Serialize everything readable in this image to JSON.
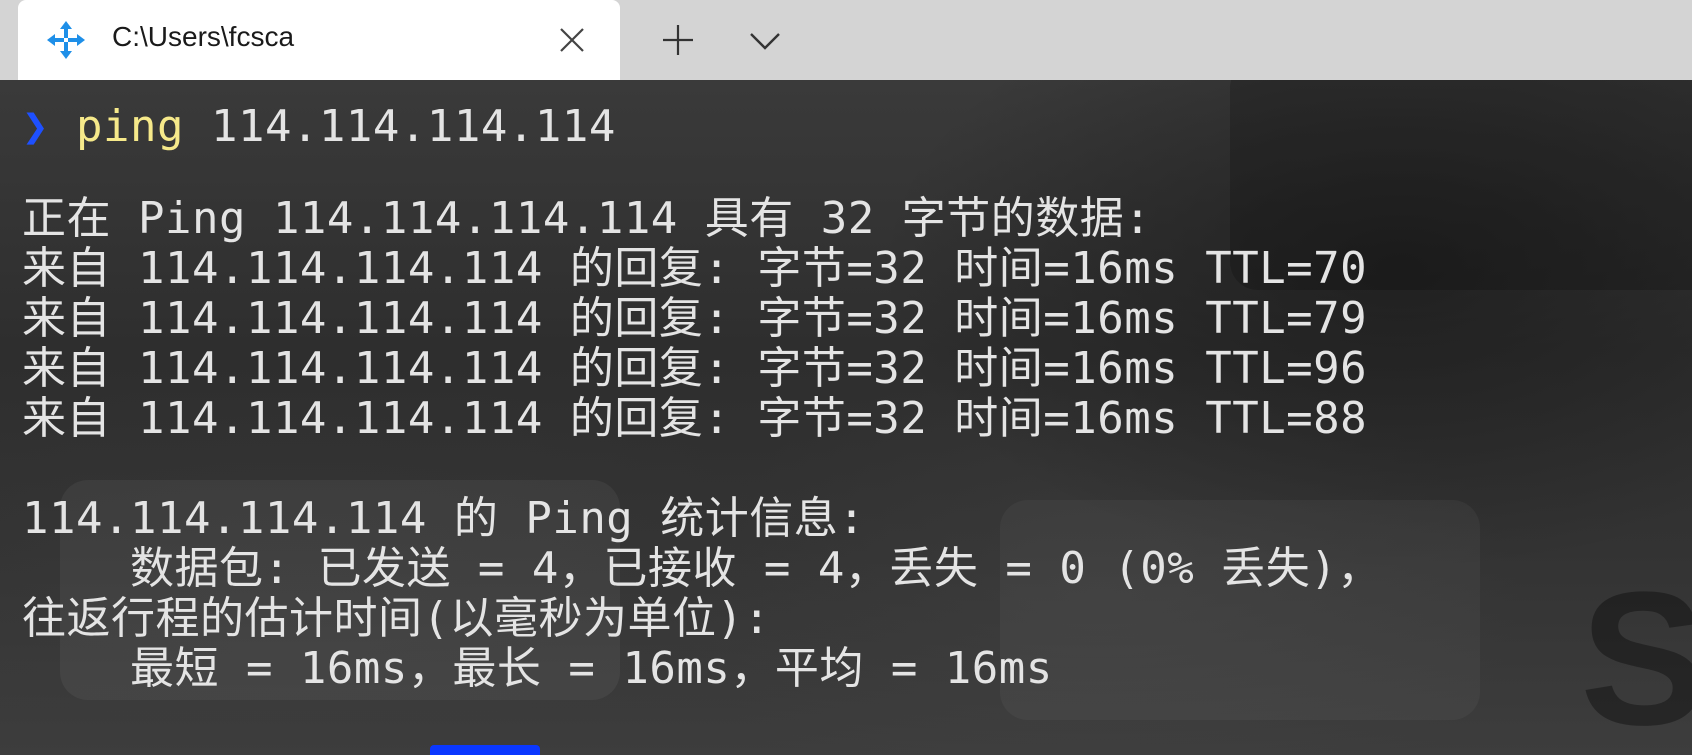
{
  "window": {
    "tab_title": "C:\\Users\\fcsca",
    "tab_icon": "app-move-icon",
    "close_icon": "close-icon",
    "new_tab_icon": "plus-icon",
    "dropdown_icon": "chevron-down-icon"
  },
  "terminal": {
    "prompt_symbol": "❯",
    "command": "ping",
    "argument": " 114.114.114.114",
    "lines": [
      "正在 Ping 114.114.114.114 具有 32 字节的数据:",
      "来自 114.114.114.114 的回复: 字节=32 时间=16ms TTL=70",
      "来自 114.114.114.114 的回复: 字节=32 时间=16ms TTL=79",
      "来自 114.114.114.114 的回复: 字节=32 时间=16ms TTL=96",
      "来自 114.114.114.114 的回复: 字节=32 时间=16ms TTL=88",
      "114.114.114.114 的 Ping 统计信息:",
      "    数据包: 已发送 = 4，已接收 = 4，丢失 = 0 (0% 丢失)，",
      "往返行程的估计时间(以毫秒为单位):",
      "    最短 = 16ms，最长 = 16ms，平均 = 16ms"
    ],
    "background_letter": "S"
  },
  "colors": {
    "prompt": "#1e50ff",
    "command": "#f6e98a",
    "text": "#e4e4e4",
    "titlebar": "#d4d4d4"
  }
}
